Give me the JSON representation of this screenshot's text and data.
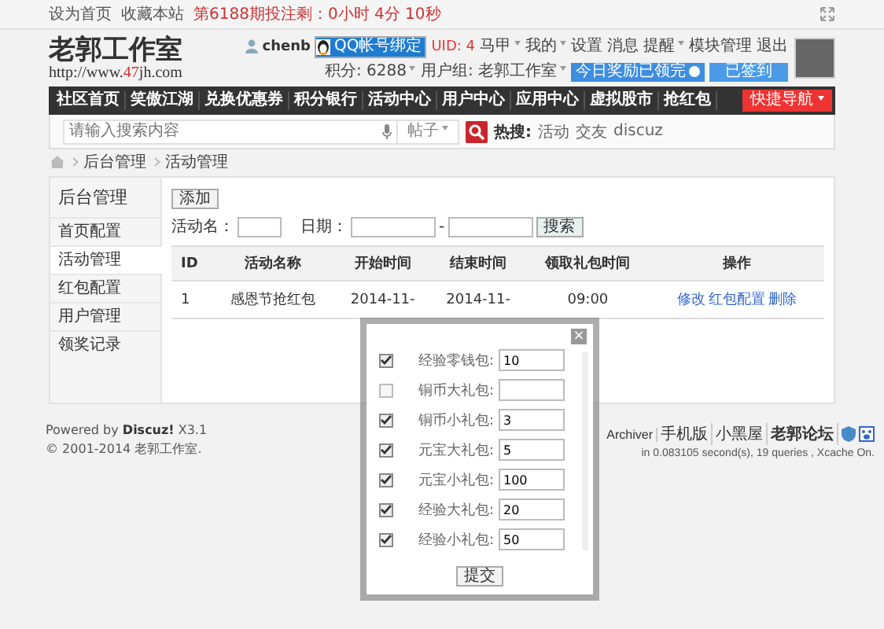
{
  "topbar": {
    "links": [
      "设为首页",
      "收藏本站"
    ],
    "notice": "第6188期投注剩：0小时 4分 10秒"
  },
  "header": {
    "logo": "老郭工作室",
    "logo_url_pre": "http://www.",
    "logo_url_num": "47",
    "logo_url_post": "jh.com",
    "user": "chenb",
    "qq_bind": "QQ帐号绑定",
    "uid": "UID: 4",
    "menus": [
      {
        "label": "马甲",
        "dropdown": true
      },
      {
        "label": "我的",
        "dropdown": true
      },
      {
        "label": "设置",
        "dropdown": false
      },
      {
        "label": "消息",
        "dropdown": false
      },
      {
        "label": "提醒",
        "dropdown": true
      },
      {
        "label": "模块管理",
        "dropdown": false
      },
      {
        "label": "退出",
        "dropdown": false
      }
    ],
    "points": "积分: 6288",
    "group": "用户组: 老郭工作室",
    "reward": "今日奖励已领完",
    "signed": "已签到"
  },
  "nav": {
    "items": [
      "社区首页",
      "笑傲江湖",
      "兑换优惠券",
      "积分银行",
      "活动中心",
      "用户中心",
      "应用中心",
      "虚拟股市",
      "抢红包"
    ],
    "quick": "快捷导航"
  },
  "search": {
    "placeholder": "请输入搜索内容",
    "type": "帖子",
    "hot_label": "热搜:",
    "hot": [
      "活动",
      "交友",
      "discuz"
    ]
  },
  "breadcrumb": [
    "后台管理",
    "活动管理"
  ],
  "sidebar": {
    "title": "后台管理",
    "items": [
      {
        "label": "首页配置",
        "selected": false
      },
      {
        "label": "活动管理",
        "selected": true
      },
      {
        "label": "红包配置",
        "selected": false
      },
      {
        "label": "用户管理",
        "selected": false
      },
      {
        "label": "领奖记录",
        "selected": false
      }
    ]
  },
  "filter": {
    "add": "添加",
    "name_label": "活动名：",
    "date_label": "日期：",
    "dash": "-",
    "search": "搜索"
  },
  "table": {
    "columns": [
      "ID",
      "活动名称",
      "开始时间",
      "结束时间",
      "领取礼包时间",
      "操作"
    ],
    "rows": [
      {
        "cells": [
          "1",
          "感恩节抢红包",
          "2014-11-",
          "2014-11-",
          "09:00"
        ],
        "actions": [
          "修改",
          "红包配置",
          "删除"
        ]
      }
    ]
  },
  "footer": {
    "powered": "Powered by **Discuz!** X3.1",
    "copyright": "© 2001-2014 老郭工作室.",
    "links": [
      "Archiver",
      "手机版",
      "小黑屋",
      "老郭论坛"
    ],
    "stats": "in 0.083105 second(s), 19 queries , Xcache On."
  },
  "dialog": {
    "close": "×",
    "rows": [
      {
        "label": "经验零钱包:",
        "checked": true,
        "value": "10"
      },
      {
        "label": "铜币大礼包:",
        "checked": false,
        "value": ""
      },
      {
        "label": "铜币小礼包:",
        "checked": true,
        "value": "3"
      },
      {
        "label": "元宝大礼包:",
        "checked": true,
        "value": "5"
      },
      {
        "label": "元宝小礼包:",
        "checked": true,
        "value": "100"
      },
      {
        "label": "经验大礼包:",
        "checked": true,
        "value": "20"
      },
      {
        "label": "经验小礼包:",
        "checked": true,
        "value": "50"
      }
    ],
    "submit": "提交"
  }
}
